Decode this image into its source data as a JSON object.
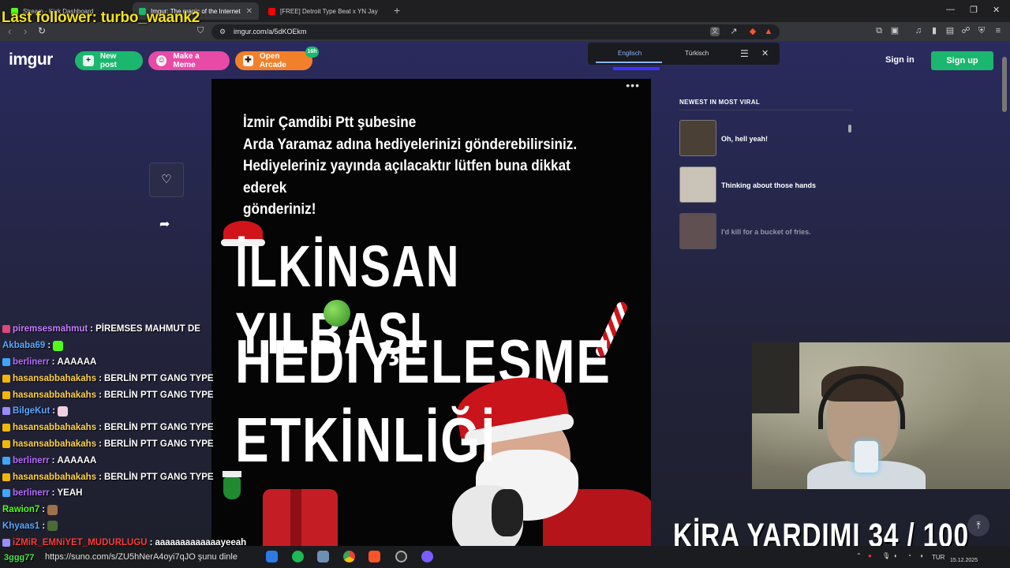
{
  "overlay": {
    "last_follower": "Last follower: turbo_waank2",
    "kira": "KİRA YARDIMI  34 / 100"
  },
  "browser": {
    "tabs": [
      {
        "title": "Stream - Kick Dashboard",
        "favicon_color": "#53fc18"
      },
      {
        "title": "Imgur: The magic of the Internet",
        "favicon_color": "#1bb76e"
      },
      {
        "title": "[FREE] Detroit Type Beat x YN Jay",
        "favicon_color": "#ff0000"
      }
    ],
    "url": "imgur.com/a/5dKOEkm",
    "translate": {
      "lang1": "Englisch",
      "lang2": "Türkisch"
    }
  },
  "imgur": {
    "logo": "imgur",
    "new_post": "New post",
    "make_meme": "Make a Meme",
    "open_arcade": "Open Arcade",
    "arcade_badge": "16h",
    "sign_in": "Sign in",
    "sign_up": "Sign up",
    "post": {
      "more": "•••",
      "text_lines": [
        "İzmir Çamdibi Ptt şubesine",
        "Arda Yaramaz adına hediyelerinizi gönderebilirsiniz.",
        "Hediyeleriniz yayında açılacaktır lütfen buna dikkat ederek",
        "gönderiniz!"
      ],
      "big1": "İLKİNSAN YILBAŞI",
      "big2": "HEDİYELEŞME",
      "big3": "ETKİNLİĞİ"
    },
    "sidebar": {
      "heading": "NEWEST IN MOST VIRAL",
      "items": [
        {
          "title": "Oh, hell yeah!",
          "color": "#4a4036"
        },
        {
          "title": "Thinking about those hands",
          "color": "#c9c3b8"
        },
        {
          "title": "I'd kill for a bucket of fries.",
          "color": "#9b7a5c"
        }
      ]
    }
  },
  "chat": [
    {
      "user": "piremsesmahmut",
      "msg": "PİREMSES MAHMUT DE",
      "color": "#c77dff",
      "badge": "#e0457b"
    },
    {
      "user": "Akbaba69",
      "msg": "",
      "color": "#5aa9ff",
      "badge": "",
      "emote": "#53fc18"
    },
    {
      "user": "berlinerr",
      "msg": "AAAAAA",
      "color": "#b56cff",
      "badge": "#3ea6ff"
    },
    {
      "user": "hasansabbahakahs",
      "msg": "BERLİN PTT GANG TYPE",
      "color": "#ffd34a",
      "badge": "#f2b705"
    },
    {
      "user": "hasansabbahakahs",
      "msg": "BERLİN PTT GANG TYPE",
      "color": "#ffd34a",
      "badge": "#f2b705"
    },
    {
      "user": "BilgeKut",
      "msg": "",
      "color": "#5aa9ff",
      "badge": "#9b8cff",
      "emote": "#f0d0e0"
    },
    {
      "user": "hasansabbahakahs",
      "msg": "BERLİN PTT GANG TYPE",
      "color": "#ffd34a",
      "badge": "#f2b705"
    },
    {
      "user": "hasansabbahakahs",
      "msg": "BERLİN PTT GANG TYPE",
      "color": "#ffd34a",
      "badge": "#f2b705"
    },
    {
      "user": "berlinerr",
      "msg": "AAAAAA",
      "color": "#b56cff",
      "badge": "#3ea6ff"
    },
    {
      "user": "hasansabbahakahs",
      "msg": "BERLİN PTT GANG TYPE",
      "color": "#ffd34a",
      "badge": "#f2b705"
    },
    {
      "user": "berlinerr",
      "msg": "YEAH",
      "color": "#b56cff",
      "badge": "#3ea6ff"
    },
    {
      "user": "Rawion7",
      "msg": "",
      "color": "#53fc18",
      "badge": "",
      "emote": "#a0704a"
    },
    {
      "user": "Khyaas1",
      "msg": "",
      "color": "#5aa9ff",
      "badge": "",
      "emote": "#4a6a3a"
    },
    {
      "user": "iZMiR_EMNiYET_MUDURLUGU",
      "msg": "aaaaaaaaaaaaayeeah",
      "color": "#ff3b3b",
      "badge": "#9b8cff"
    }
  ],
  "taskbar": {
    "search_user": "3ggg77",
    "search_text": "https://suno.com/s/ZU5hNerA4oyi7qJO şunu dinle",
    "lang": "TUR",
    "date": "15.12.2025"
  }
}
